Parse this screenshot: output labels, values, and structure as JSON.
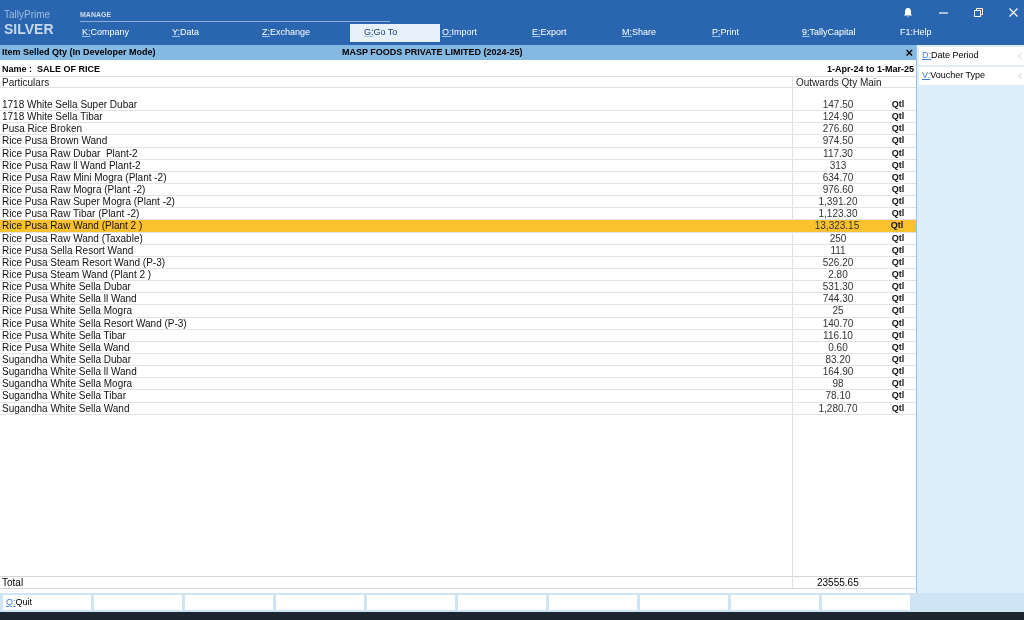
{
  "app": {
    "product": "TallyPrime",
    "edition": "SILVER"
  },
  "menu_group": "MANAGE",
  "menu": [
    {
      "key": "K:",
      "label": "Company",
      "underlined": true,
      "selected": false
    },
    {
      "key": "Y:",
      "label": "Data",
      "underlined": true,
      "selected": false
    },
    {
      "key": "Z:",
      "label": "Exchange",
      "underlined": true,
      "selected": false
    },
    {
      "key": "G:",
      "label": "Go To",
      "underlined": true,
      "selected": true
    },
    {
      "key": "O:",
      "label": "Import",
      "underlined": true,
      "selected": false
    },
    {
      "key": "E:",
      "label": "Export",
      "underlined": true,
      "selected": false
    },
    {
      "key": "M:",
      "label": "Share",
      "underlined": true,
      "selected": false
    },
    {
      "key": "P:",
      "label": "Print",
      "underlined": true,
      "selected": false
    },
    {
      "key": "9:",
      "label": "TallyCapital",
      "underlined": true,
      "selected": false
    },
    {
      "key": "F1:",
      "label": "Help",
      "underlined": false,
      "selected": false
    }
  ],
  "report": {
    "title": "Item Selled Qty  (In Developer Mode)",
    "company": "MASP FOODS PRIVATE LIMITED (2024-25)",
    "close": "×",
    "name": "Name :  SALE OF RICE",
    "period": "1-Apr-24 to 1-Mar-25"
  },
  "table": {
    "columns": [
      "Particulars",
      "Outwards Qty Main"
    ],
    "rows": [
      {
        "item": "1718 White Sella Super Dubar",
        "qty": "147.50",
        "unit": "Qtl",
        "selected": false
      },
      {
        "item": "1718 White Sella Tibar",
        "qty": "124.90",
        "unit": "Qtl",
        "selected": false
      },
      {
        "item": "Pusa Rice Broken",
        "qty": "276.60",
        "unit": "Qtl",
        "selected": false
      },
      {
        "item": "Rice Pusa Brown Wand",
        "qty": "974.50",
        "unit": "Qtl",
        "selected": false
      },
      {
        "item": "Rice Pusa Raw Dubar  Plant-2",
        "qty": "117.30",
        "unit": "Qtl",
        "selected": false
      },
      {
        "item": "Rice Pusa Raw ll Wand Plant-2",
        "qty": "313",
        "unit": "Qtl",
        "selected": false
      },
      {
        "item": "Rice Pusa Raw Mini Mogra (Plant -2)",
        "qty": "634.70",
        "unit": "Qtl",
        "selected": false
      },
      {
        "item": "Rice Pusa Raw Mogra (Plant -2)",
        "qty": "976.60",
        "unit": "Qtl",
        "selected": false
      },
      {
        "item": "Rice Pusa Raw Super Mogra (Plant -2)",
        "qty": "1,391.20",
        "unit": "Qtl",
        "selected": false
      },
      {
        "item": "Rice Pusa Raw Tibar (Plant -2)",
        "qty": "1,123.30",
        "unit": "Qtl",
        "selected": false
      },
      {
        "item": "Rice Pusa Raw Wand (Plant 2 )",
        "qty": "13,323.15",
        "unit": "Qtl",
        "selected": true
      },
      {
        "item": "Rice Pusa Raw Wand (Taxable)",
        "qty": "250",
        "unit": "Qtl",
        "selected": false
      },
      {
        "item": "Rice Pusa Sella Resort Wand",
        "qty": "111",
        "unit": "Qtl",
        "selected": false
      },
      {
        "item": "Rice Pusa Steam Resort Wand (P-3)",
        "qty": "526.20",
        "unit": "Qtl",
        "selected": false
      },
      {
        "item": "Rice Pusa Steam Wand (Plant 2 )",
        "qty": "2.80",
        "unit": "Qtl",
        "selected": false
      },
      {
        "item": "Rice Pusa White Sella Dubar",
        "qty": "531.30",
        "unit": "Qtl",
        "selected": false
      },
      {
        "item": "Rice Pusa White Sella ll Wand",
        "qty": "744.30",
        "unit": "Qtl",
        "selected": false
      },
      {
        "item": "Rice Pusa White Sella Mogra",
        "qty": "25",
        "unit": "Qtl",
        "selected": false
      },
      {
        "item": "Rice Pusa White Sella Resort Wand (P-3)",
        "qty": "140.70",
        "unit": "Qtl",
        "selected": false
      },
      {
        "item": "Rice Pusa White Sella Tibar",
        "qty": "116.10",
        "unit": "Qtl",
        "selected": false
      },
      {
        "item": "Rice Pusa White Sella Wand",
        "qty": "0.60",
        "unit": "Qtl",
        "selected": false
      },
      {
        "item": "Sugandha White Sella Dubar",
        "qty": "83.20",
        "unit": "Qtl",
        "selected": false
      },
      {
        "item": "Sugandha White Sella ll Wand",
        "qty": "164.90",
        "unit": "Qtl",
        "selected": false
      },
      {
        "item": "Sugandha White Sella Mogra",
        "qty": "98",
        "unit": "Qtl",
        "selected": false
      },
      {
        "item": "Sugandha White Sella Tibar",
        "qty": "78.10",
        "unit": "Qtl",
        "selected": false
      },
      {
        "item": "Sugandha White Sella Wand",
        "qty": "1,280.70",
        "unit": "Qtl",
        "selected": false
      }
    ],
    "total_label": "Total",
    "total": "23555.65"
  },
  "side_buttons": [
    {
      "key": "D:",
      "label": "Date Period"
    },
    {
      "key": "V:",
      "label": "Voucher Type"
    }
  ],
  "footer_buttons": [
    {
      "key": "Q:",
      "label": "Quit"
    }
  ]
}
